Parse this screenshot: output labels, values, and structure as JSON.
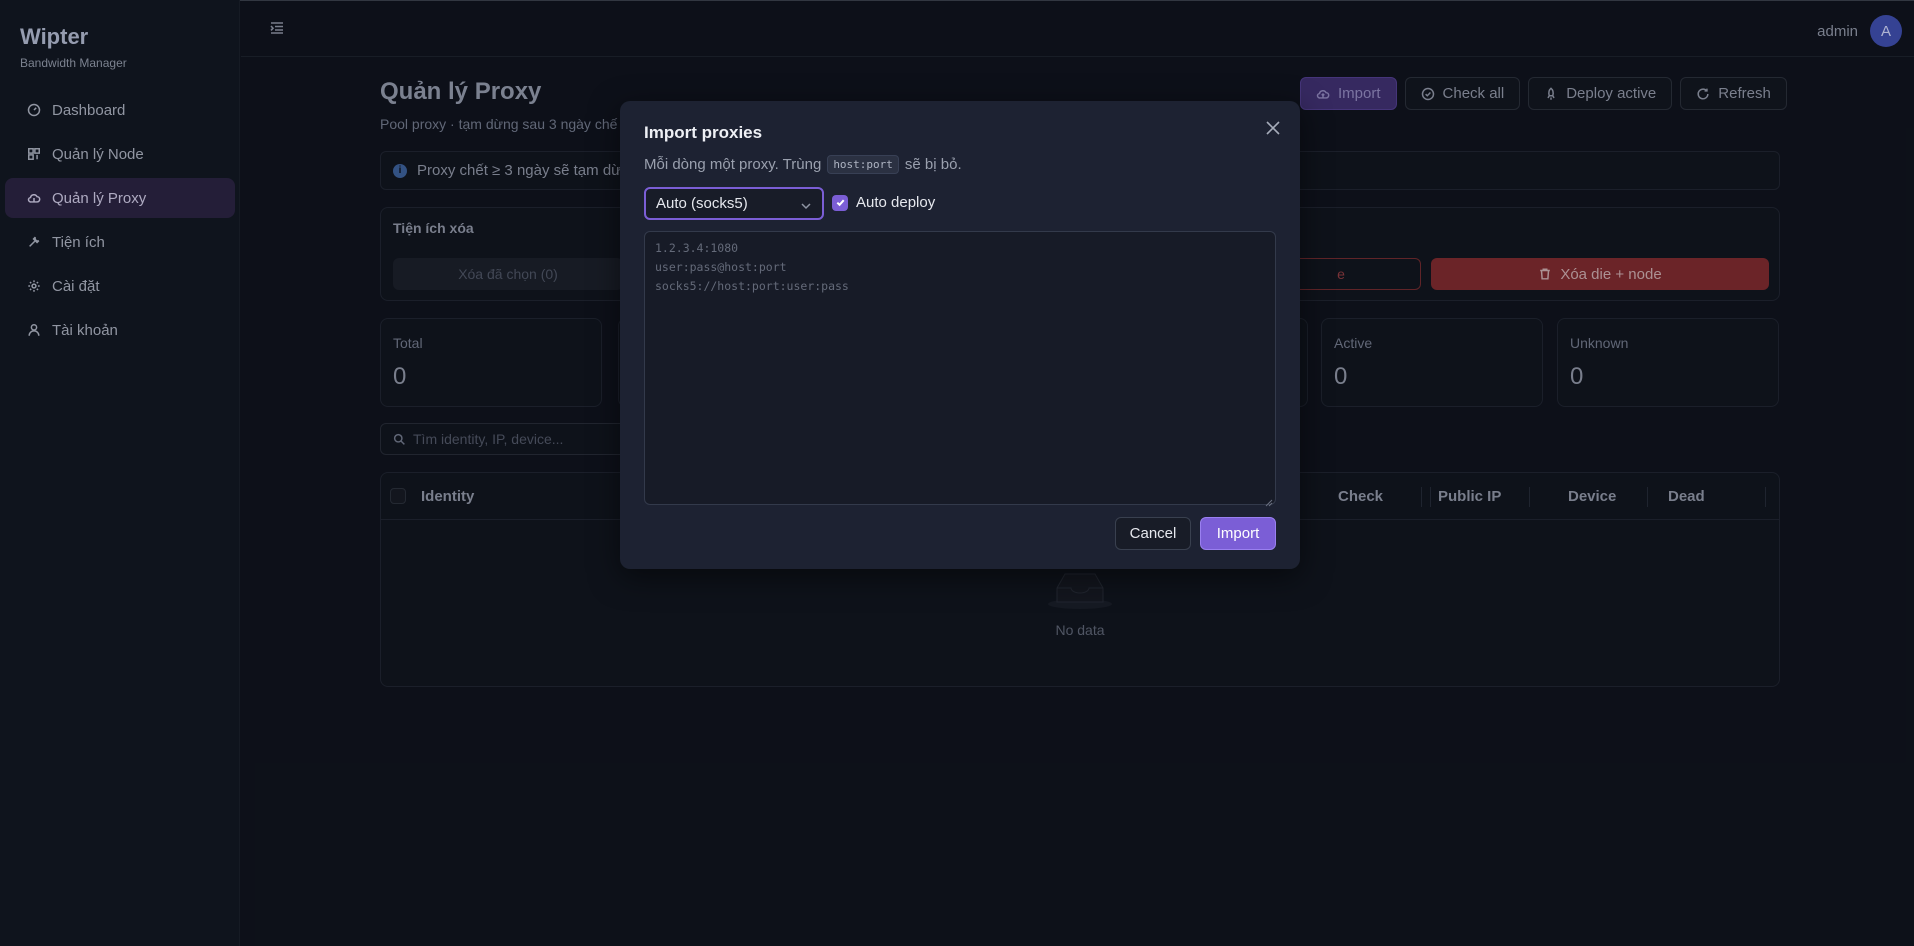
{
  "brand": {
    "title": "Wipter",
    "subtitle": "Bandwidth Manager"
  },
  "sidebar": {
    "items": [
      {
        "label": "Dashboard",
        "icon": "dashboard-icon",
        "active": false
      },
      {
        "label": "Quản lý Node",
        "icon": "server-icon",
        "active": false
      },
      {
        "label": "Quản lý Proxy",
        "icon": "cloud-icon",
        "active": true
      },
      {
        "label": "Tiện ích",
        "icon": "tool-icon",
        "active": false
      },
      {
        "label": "Cài đặt",
        "icon": "gear-icon",
        "active": false
      },
      {
        "label": "Tài khoản",
        "icon": "user-icon",
        "active": false
      }
    ]
  },
  "header": {
    "user_name": "admin",
    "avatar_letter": "A"
  },
  "page": {
    "title": "Quản lý Proxy",
    "subtitle": "Pool proxy · tạm dừng sau 3 ngày chế",
    "actions": {
      "import": "Import",
      "check_all": "Check all",
      "deploy_active": "Deploy active",
      "refresh": "Refresh"
    },
    "info": "Proxy chết ≥ 3 ngày sẽ tạm dừn"
  },
  "tools": {
    "title": "Tiện ích xóa",
    "delete_selected": "Xóa đã chọn (0)",
    "delete_die_partial": "e",
    "delete_die_node": "Xóa die + node"
  },
  "stats": {
    "total": {
      "label": "Total",
      "value": "0"
    },
    "active": {
      "label": "Active",
      "value": "0"
    },
    "unknown": {
      "label": "Unknown",
      "value": "0"
    }
  },
  "search": {
    "placeholder": "Tìm identity, IP, device..."
  },
  "table": {
    "columns": {
      "identity": "Identity",
      "check": "Check",
      "public_ip": "Public IP",
      "device": "Device",
      "dead": "Dead"
    },
    "empty_text": "No data"
  },
  "modal": {
    "title": "Import proxies",
    "desc_before": "Mỗi dòng một proxy. Trùng",
    "desc_code": "host:port",
    "desc_after": "sẽ bị bỏ.",
    "protocol_selected": "Auto (socks5)",
    "auto_deploy_label": "Auto deploy",
    "auto_deploy_checked": true,
    "textarea_placeholder_lines": [
      "1.2.3.4:1080",
      "user:pass@host:port",
      "socks5://host:port:user:pass"
    ],
    "cancel_label": "Cancel",
    "import_label": "Import"
  },
  "colors": {
    "accent": "#7b5ed6",
    "danger": "#7a2a2e",
    "background": "#0f131d",
    "modal": "#1d2232"
  }
}
